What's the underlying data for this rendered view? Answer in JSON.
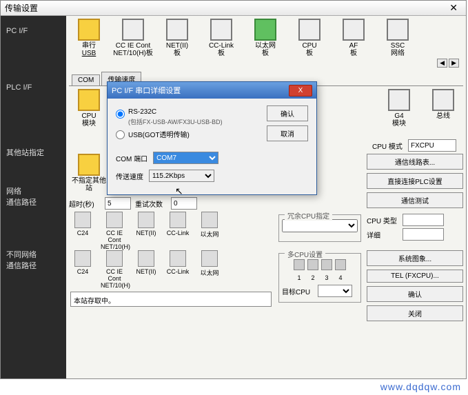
{
  "window": {
    "title": "传输设置",
    "close_glyph": "✕"
  },
  "sidebar": {
    "items": [
      {
        "label": "PC I/F"
      },
      {
        "label": "PLC I/F"
      },
      {
        "label": "其他站指定"
      },
      {
        "label": "网络\n通信路径"
      },
      {
        "label": "不同网络\n通信路径"
      }
    ]
  },
  "row1": {
    "devices": [
      {
        "label": "串行\nUSB",
        "cls": "y",
        "underline": true
      },
      {
        "label": "CC IE Cont\nNET/10(H)板"
      },
      {
        "label": "NET(II)\n板"
      },
      {
        "label": "CC-Link\n板"
      },
      {
        "label": "以太网\n板",
        "cls": "g"
      },
      {
        "label": "CPU\n板"
      },
      {
        "label": "AF\n板"
      },
      {
        "label": "SSC\n网络"
      }
    ],
    "scroll_left": "◀",
    "scroll_right": "▶"
  },
  "tabs": {
    "com": "COM",
    "rate": "传输速度"
  },
  "row2": {
    "devices": [
      {
        "label": "CPU\n模块",
        "cls": "y"
      },
      {
        "label": "G4\n模块"
      },
      {
        "label": "总线"
      }
    ],
    "cpu_mode_label": "CPU 模式",
    "cpu_mode_value": "FXCPU"
  },
  "row3": {
    "device": {
      "label": "不指定其他站",
      "cls": "y"
    },
    "timeout_label": "超时(秒)",
    "timeout_value": "5",
    "retry_label": "重试次数",
    "retry_value": "0",
    "buttons": {
      "route_table": "通信线路表...",
      "direct_plc": "直接连接PLC设置",
      "comm_test": "通信测试"
    }
  },
  "row4": {
    "legend": "冗余CPU指定",
    "devices": [
      {
        "label": "C24"
      },
      {
        "label": "CC IE Cont\nNET/10(H)"
      },
      {
        "label": "NET(II)"
      },
      {
        "label": "CC-Link"
      },
      {
        "label": "以太网"
      }
    ],
    "cpu_type_label": "CPU 类型",
    "detail_label": "详细"
  },
  "row5": {
    "legend": "多CPU设置",
    "devices": [
      {
        "label": "C24"
      },
      {
        "label": "CC IE Cont\nNET/10(H)"
      },
      {
        "label": "NET(II)"
      },
      {
        "label": "CC-Link"
      },
      {
        "label": "以太网"
      }
    ],
    "nums": [
      "1",
      "2",
      "3",
      "4"
    ],
    "target_cpu_label": "目标CPU",
    "buttons": {
      "system_img": "系统图象...",
      "tel": "TEL (FXCPU)...",
      "ok": "确认",
      "close": "关闭"
    }
  },
  "status_text": "本站存取中。",
  "dialog": {
    "title": "PC I/F 串口详细设置",
    "close_glyph": "X",
    "radio_rs232c": "RS-232C",
    "radio_rs232c_sub": "(包括FX-USB-AW/FX3U-USB-BD)",
    "radio_usb": "USB(GOT透明传输)",
    "com_label": "COM 端口",
    "com_value": "COM7",
    "rate_label": "传送速度",
    "rate_value": "115.2Kbps",
    "ok": "确认",
    "cancel": "取消"
  },
  "watermark": "www.dqdqw.com"
}
